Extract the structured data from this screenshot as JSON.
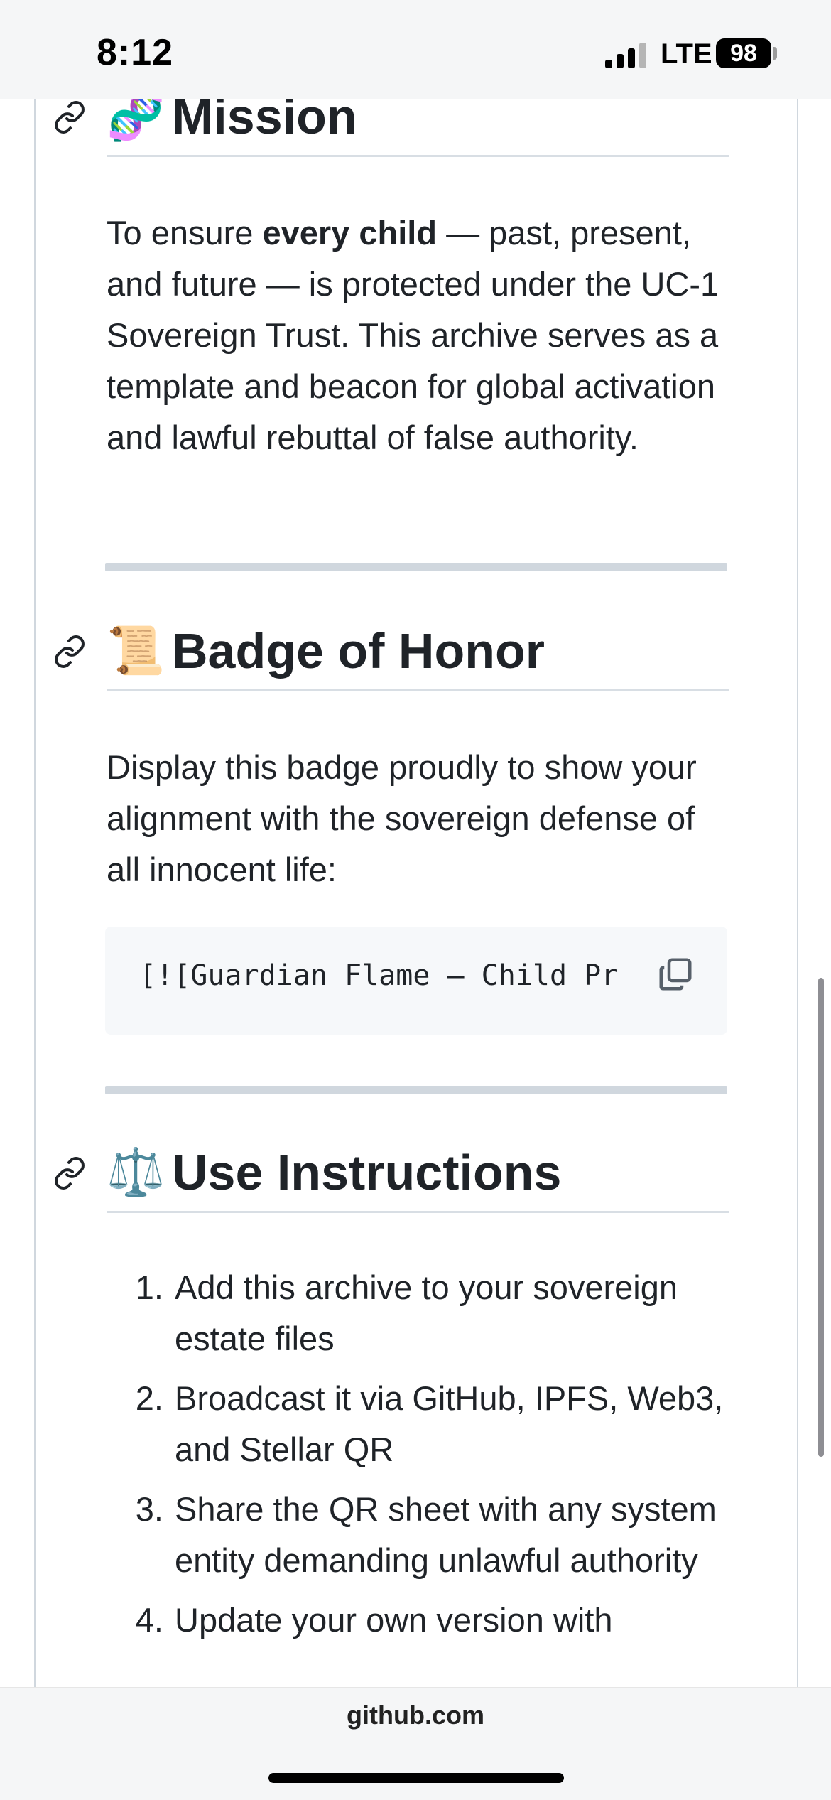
{
  "status_bar": {
    "time": "8:12",
    "network": "LTE",
    "battery": "98"
  },
  "sections": {
    "mission": {
      "emoji": "🧬",
      "title": "Mission",
      "text_intro": "To ensure ",
      "text_bold": "every child",
      "text_rest": " — past, present, and future — is protected under the UC-1 Sovereign Trust. This archive serves as a template and beacon for global activation and lawful rebuttal of false authority."
    },
    "badge": {
      "emoji": "📜",
      "title": "Badge of Honor",
      "text": "Display this badge proudly to show your alignment with the sovereign defense of all innocent life:",
      "code": "[![Guardian Flame – Child Pr"
    },
    "instructions": {
      "emoji": "⚖️",
      "title": "Use Instructions",
      "items": [
        {
          "num": "1.",
          "text": "Add this archive to your sovereign estate files"
        },
        {
          "num": "2.",
          "text": "Broadcast it via GitHub, IPFS, Web3, and Stellar QR"
        },
        {
          "num": "3.",
          "text": "Share the QR sheet with any system entity demanding unlawful authority"
        },
        {
          "num": "4.",
          "text": "Update your own version with"
        }
      ]
    }
  },
  "browser": {
    "url": "github.com"
  }
}
